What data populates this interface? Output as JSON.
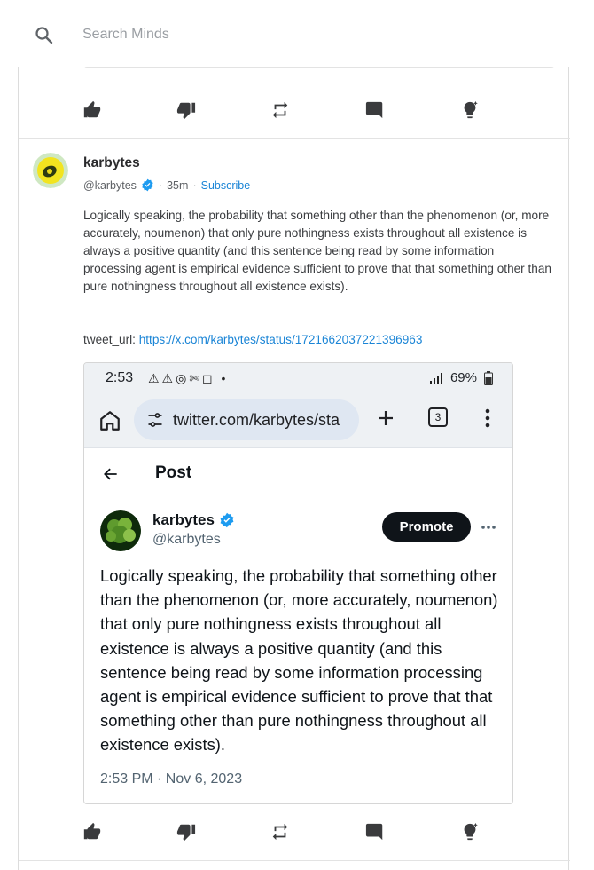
{
  "search": {
    "placeholder": "Search Minds"
  },
  "post": {
    "username": "karbytes",
    "handle": "@karbytes",
    "time_ago": "35m",
    "subscribe_label": "Subscribe",
    "body": "Logically speaking, the probability that something other than the phenomenon (or, more accurately, noumenon) that only pure nothingness exists throughout all existence is always a positive quantity (and this sentence being read by some information processing agent is empirical evidence sufficient to prove that that something other than pure nothingness throughout all existence exists).",
    "tweet_url_label": "tweet_url: ",
    "tweet_url": "https://x.com/karbytes/status/1721662037221396963"
  },
  "screenshot": {
    "status_time": "2:53",
    "status_battery": "69%",
    "browser_url": "twitter.com/karbytes/sta",
    "tab_count": "3",
    "header_title": "Post",
    "tweet_name": "karbytes",
    "tweet_handle": "@karbytes",
    "promote_label": "Promote",
    "tweet_text": "Logically speaking, the probability that something other than the phenomenon (or, more accurately, noumenon) that only pure nothingness exists throughout all existence is always a positive quantity (and this sentence being read by some information processing agent is empirical evidence sufficient to prove that that something other than pure nothingness throughout all existence exists).",
    "tweet_timestamp": "2:53 PM · Nov 6, 2023"
  },
  "actions": [
    "thumbs-up",
    "thumbs-down",
    "remind",
    "comment",
    "boost"
  ],
  "colors": {
    "link": "#1b85d6",
    "verified": "#1d9bf0",
    "accent_yellow": "#e8cc2a"
  }
}
